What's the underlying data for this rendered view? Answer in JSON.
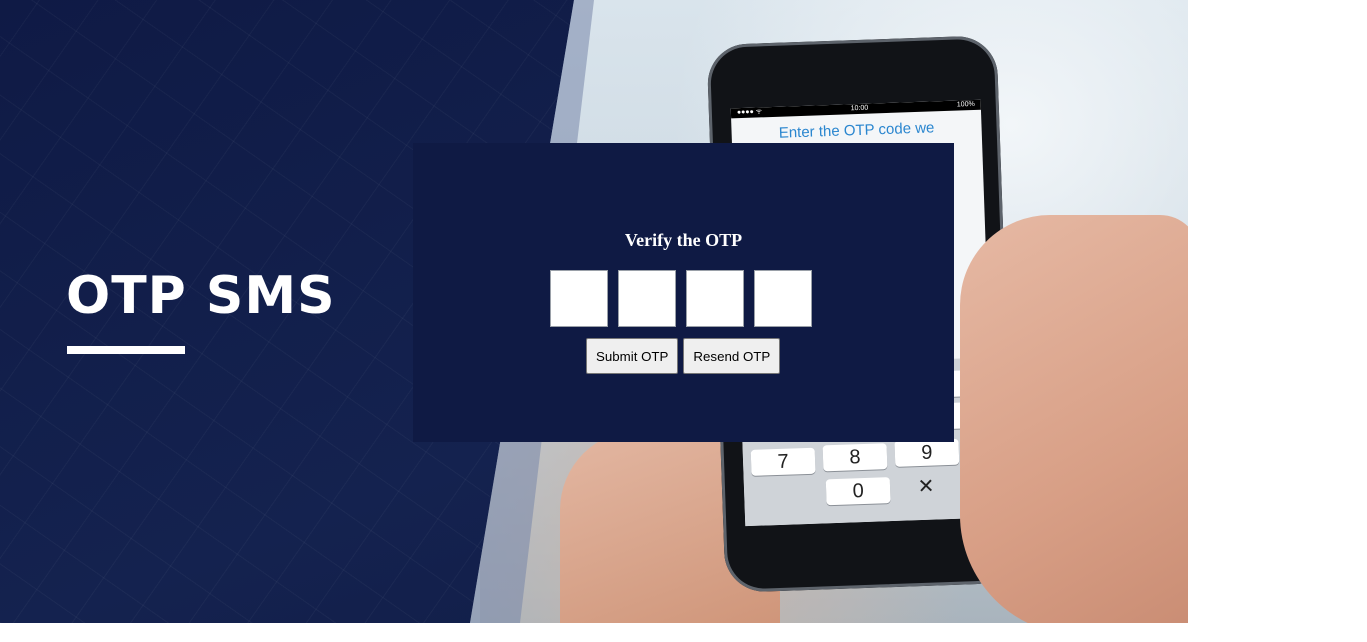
{
  "banner": {
    "title": "OTP SMS",
    "phone": {
      "status_time": "10:00",
      "status_battery": "100%",
      "prompt": "Enter the OTP code we",
      "keys": [
        "7",
        "8",
        "9",
        "0"
      ],
      "backspace_glyph": "✕"
    }
  },
  "otp_form": {
    "heading": "Verify the OTP",
    "digits": [
      "",
      "",
      "",
      ""
    ],
    "submit_label": "Submit OTP",
    "resend_label": "Resend OTP"
  },
  "colors": {
    "navy": "#0f1a44",
    "accent_text": "#2a86cf",
    "button_bg": "#efefef"
  }
}
